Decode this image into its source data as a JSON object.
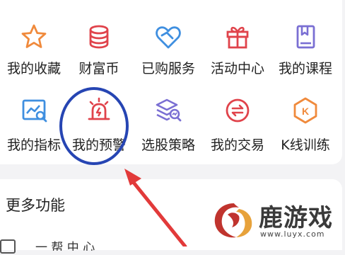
{
  "grid": {
    "row1": [
      {
        "label": "我的收藏",
        "icon": "star-icon"
      },
      {
        "label": "财富币",
        "icon": "coin-stack-icon"
      },
      {
        "label": "已购服务",
        "icon": "heart-ribbon-icon"
      },
      {
        "label": "活动中心",
        "icon": "gift-icon"
      },
      {
        "label": "我的课程",
        "icon": "book-icon"
      }
    ],
    "row2": [
      {
        "label": "我的指标",
        "icon": "chart-search-icon"
      },
      {
        "label": "我的预警",
        "icon": "alarm-siren-icon"
      },
      {
        "label": "选股策略",
        "icon": "layers-search-icon"
      },
      {
        "label": "我的交易",
        "icon": "exchange-icon"
      },
      {
        "label": "K线训练",
        "icon": "k-badge-icon",
        "badge": "K"
      }
    ]
  },
  "more": {
    "title": "更多功能",
    "partial_text": "一 帮 中 心"
  },
  "watermark": {
    "brand": "鹿游戏",
    "url": "www.luyx.com"
  },
  "colors": {
    "orange": "#f08a3c",
    "red": "#e0434b",
    "blue": "#3f8fe0",
    "purple": "#7a6fd3",
    "circle": "#2645b3",
    "arrow": "#e23a3a"
  }
}
